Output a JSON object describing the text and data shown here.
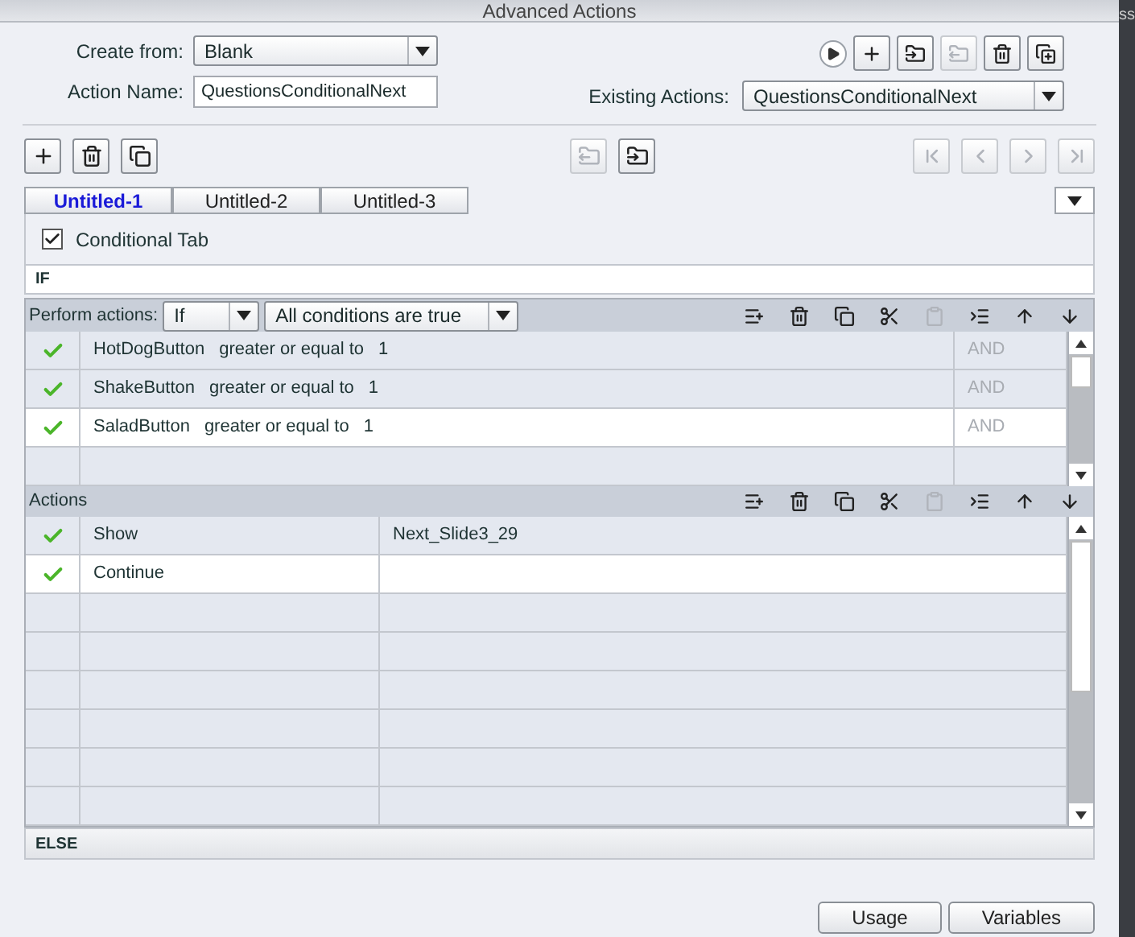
{
  "window": {
    "title": "Advanced Actions"
  },
  "edge_text": "ss",
  "create_from": {
    "label": "Create from:",
    "value": "Blank"
  },
  "action_name": {
    "label": "Action Name:",
    "value": "QuestionsConditionalNext"
  },
  "existing_actions": {
    "label": "Existing Actions:",
    "value": "QuestionsConditionalNext"
  },
  "top_tools": [
    {
      "kind": "play",
      "disabled": false
    },
    {
      "kind": "add",
      "disabled": false
    },
    {
      "kind": "import",
      "disabled": false
    },
    {
      "kind": "export",
      "disabled": true
    },
    {
      "kind": "delete",
      "disabled": false
    },
    {
      "kind": "duplicate",
      "disabled": false
    }
  ],
  "left_tools": [
    {
      "kind": "add",
      "disabled": false
    },
    {
      "kind": "delete",
      "disabled": false
    },
    {
      "kind": "copy",
      "disabled": false
    }
  ],
  "middle_tools": [
    {
      "kind": "export",
      "disabled": true
    },
    {
      "kind": "import",
      "disabled": false
    }
  ],
  "nav_tools": [
    {
      "kind": "first",
      "disabled": true
    },
    {
      "kind": "prev",
      "disabled": true
    },
    {
      "kind": "next",
      "disabled": true
    },
    {
      "kind": "last",
      "disabled": true
    }
  ],
  "tabs": [
    {
      "label": "Untitled-1",
      "selected": true
    },
    {
      "label": "Untitled-2",
      "selected": false
    },
    {
      "label": "Untitled-3",
      "selected": false
    }
  ],
  "conditional_tab": {
    "label": "Conditional Tab",
    "checked": true
  },
  "if_label": "IF",
  "perform": {
    "label": "Perform actions:",
    "mode": "If",
    "condition": "All conditions are true"
  },
  "grid_tools": [
    {
      "kind": "insert",
      "disabled": false
    },
    {
      "kind": "delete",
      "disabled": false
    },
    {
      "kind": "copy",
      "disabled": false
    },
    {
      "kind": "cut",
      "disabled": false
    },
    {
      "kind": "paste",
      "disabled": true
    },
    {
      "kind": "indent",
      "disabled": false
    },
    {
      "kind": "up",
      "disabled": false
    },
    {
      "kind": "down",
      "disabled": false
    }
  ],
  "conditions": [
    {
      "enabled": true,
      "variable": "HotDogButton",
      "operator": "greater or equal to",
      "value": "1",
      "joiner": "AND",
      "selected": false
    },
    {
      "enabled": true,
      "variable": "ShakeButton",
      "operator": "greater or equal to",
      "value": "1",
      "joiner": "AND",
      "selected": false
    },
    {
      "enabled": true,
      "variable": "SaladButton",
      "operator": "greater or equal to",
      "value": "1",
      "joiner": "AND",
      "selected": true
    }
  ],
  "actions_label": "Actions",
  "actions": [
    {
      "enabled": true,
      "action": "Show",
      "target": "Next_Slide3_29",
      "selected": false
    },
    {
      "enabled": true,
      "action": "Continue",
      "selected": true
    }
  ],
  "else_label": "ELSE",
  "buttons": [
    "Usage",
    "Variables"
  ]
}
